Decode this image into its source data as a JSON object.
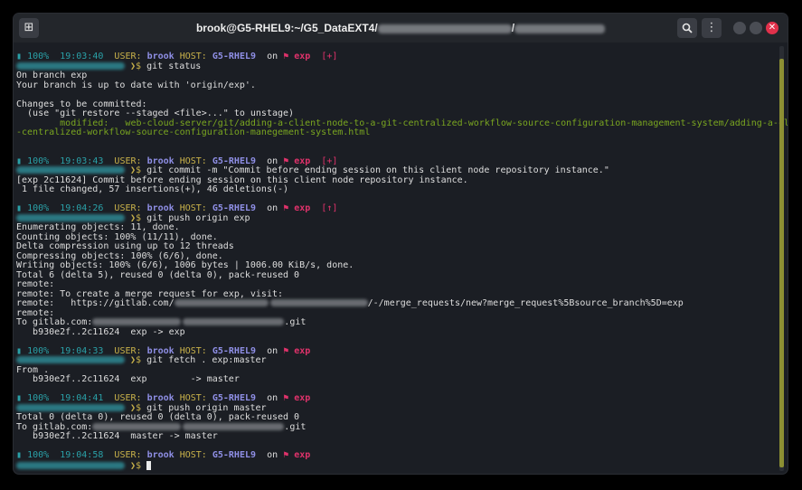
{
  "window": {
    "title_prefix": "brook@G5-RHEL9:~/G5_DataEXT4/",
    "title_sep": "/",
    "new_tab_icon": "new-tab-icon",
    "search_icon": "search-icon",
    "menu_icon": "kebab-menu-icon",
    "close_glyph": "✕"
  },
  "prompt": {
    "pct": "100%",
    "user_label": "USER:",
    "user": "brook",
    "host_label": "HOST:",
    "host": "G5-RHEL9",
    "on": "on",
    "branch_flag": "⚑",
    "branch": "exp",
    "arrow": "❯$"
  },
  "blocks": [
    {
      "time": "19:03:40",
      "status": "[+]",
      "command": "git status",
      "output": [
        "On branch exp",
        "Your branch is up to date with 'origin/exp'.",
        "",
        "Changes to be committed:",
        "  (use \"git restore --staged <file>...\" to unstage)"
      ],
      "modified_label": "        modified:   ",
      "modified_path_1": "web-cloud-server/git/adding-a-client-node-to-a-git-centralized-workflow-source-configuration-management-system/adding-a-client-node-in-a-git",
      "modified_path_2": "-centralized-workflow-source-configuration-manegement-system.html"
    },
    {
      "time": "19:03:43",
      "status": "[+]",
      "command": "git commit -m \"Commit before ending session on this client node repository instance.\"",
      "output": [
        "[exp 2c11624] Commit before ending session on this client node repository instance.",
        " 1 file changed, 57 insertions(+), 46 deletions(-)"
      ]
    },
    {
      "time": "19:04:26",
      "status": "[↑]",
      "command": "git push origin exp",
      "output": [
        "Enumerating objects: 11, done.",
        "Counting objects: 100% (11/11), done.",
        "Delta compression using up to 12 threads",
        "Compressing objects: 100% (6/6), done.",
        "Writing objects: 100% (6/6), 1006 bytes | 1006.00 KiB/s, done.",
        "Total 6 (delta 5), reused 0 (delta 0), pack-reused 0",
        "remote:",
        "remote: To create a merge request for exp, visit:"
      ],
      "remote_url_prefix": "remote:   https://gitlab.com/",
      "remote_url_suffix": "/-/merge_requests/new?merge_request%5Bsource_branch%5D=exp",
      "remote_blank": "remote:",
      "to_prefix": "To gitlab.com:",
      "to_suffix": ".git",
      "ref_line": "   b930e2f..2c11624  exp -> exp"
    },
    {
      "time": "19:04:33",
      "command": "git fetch . exp:master",
      "output": [
        "From .",
        "   b930e2f..2c11624  exp        -> master"
      ]
    },
    {
      "time": "19:04:41",
      "command": "git push origin master",
      "output": [
        "Total 0 (delta 0), reused 0 (delta 0), pack-reused 0"
      ],
      "to_prefix": "To gitlab.com:",
      "to_suffix": ".git",
      "ref_line": "   b930e2f..2c11624  master -> master"
    },
    {
      "time": "19:04:58"
    }
  ],
  "colors": {
    "background": "#1b1e24",
    "accent_teal": "#2aa1a8",
    "branch_red": "#e0326b",
    "host_yellow": "#c9b24a",
    "user_violet": "#8f8fe6",
    "modified_green": "#7aa620",
    "close_red": "#e0314b"
  }
}
